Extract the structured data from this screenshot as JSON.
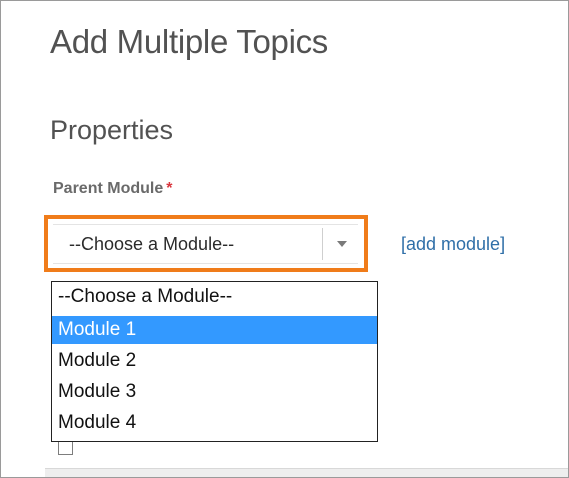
{
  "page": {
    "title": "Add Multiple Topics"
  },
  "properties": {
    "section_title": "Properties",
    "parent_module": {
      "label": "Parent Module",
      "required_marker": "*",
      "selected_value": "--Choose a Module--",
      "add_link_label": "[add module]",
      "options": [
        "--Choose a Module--",
        "Module 1",
        "Module 2",
        "Module 3",
        "Module 4"
      ],
      "highlighted_option": "Module 1"
    }
  },
  "colors": {
    "highlight_border": "#f07c1a",
    "selected_option_bg": "#3399ff",
    "link": "#2f6fa8",
    "required": "#d9363e"
  }
}
